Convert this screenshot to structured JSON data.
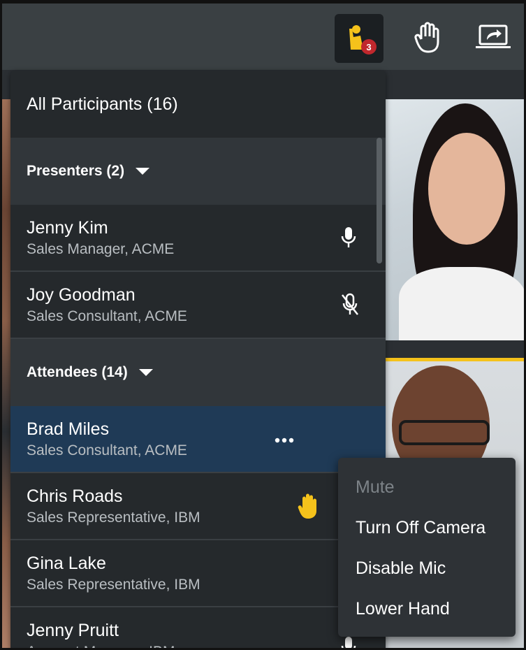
{
  "toolbar": {
    "participants_button": {
      "icon": "participants-icon",
      "badge_count": "3"
    },
    "raise_hand_button": {
      "icon": "hand-icon"
    },
    "share_screen_button": {
      "icon": "share-screen-icon"
    }
  },
  "panel": {
    "title": "All Participants (16)",
    "sections": [
      {
        "label": "Presenters (2)",
        "people": [
          {
            "name": "Jenny Kim",
            "title": "Sales Manager, ACME",
            "status_icon": "mic-icon"
          },
          {
            "name": "Joy Goodman",
            "title": "Sales Consultant, ACME",
            "status_icon": "mic-muted-icon"
          }
        ]
      },
      {
        "label": "Attendees (14)",
        "people": [
          {
            "name": "Brad Miles",
            "title": "Sales Consultant, ACME",
            "status_icon": "more-icon",
            "selected": true
          },
          {
            "name": "Chris Roads",
            "title": "Sales Representative, IBM",
            "status_icon": "raised-hand-icon"
          },
          {
            "name": "Gina Lake",
            "title": "Sales Representative, IBM",
            "status_icon": ""
          },
          {
            "name": "Jenny Pruitt",
            "title": "Account Manager, IBM",
            "status_icon": "mic-icon"
          }
        ]
      }
    ]
  },
  "context_menu": {
    "items": [
      "Mute",
      "Turn Off Camera",
      "Disable Mic",
      "Lower Hand"
    ]
  },
  "colors": {
    "accent": "#f5c21b",
    "badge": "#c0282d",
    "selected_row": "#1f3a56",
    "panel_bg": "#25292c"
  }
}
